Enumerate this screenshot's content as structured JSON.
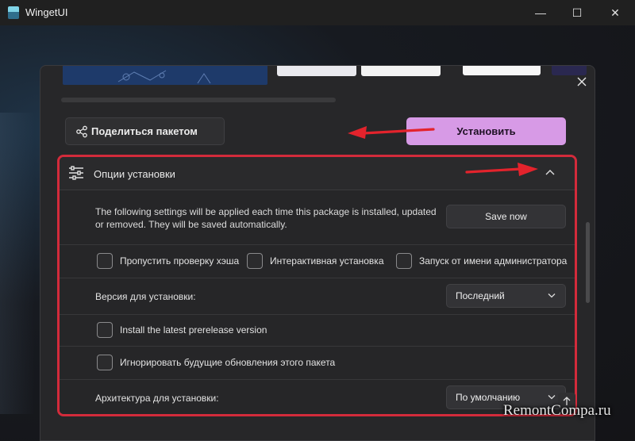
{
  "window": {
    "title": "WingetUI",
    "minimize_glyph": "—",
    "maximize_glyph": "☐",
    "close_glyph": "✕"
  },
  "dialog": {
    "share_button_label": "Поделиться пакетом",
    "install_button_label": "Установить",
    "colors": {
      "install_accent": "#d79ae6",
      "highlight_border": "#d32b3b"
    }
  },
  "install_options": {
    "title": "Опции установки",
    "info_text": "The following settings will be applied each time this package is installed, updated or removed. They will be saved automatically.",
    "save_button_label": "Save now",
    "checkboxes": [
      {
        "label": "Пропустить проверку хэша",
        "checked": false
      },
      {
        "label": "Интерактивная установка",
        "checked": false
      },
      {
        "label": "Запуск от имени администратора",
        "checked": false
      }
    ],
    "version_label": "Версия для установки:",
    "version_value": "Последний",
    "prerelease_label": "Install the latest prerelease version",
    "prerelease_checked": false,
    "ignore_updates_label": "Игнорировать будущие обновления этого пакета",
    "ignore_updates_checked": false,
    "architecture_label": "Архитектура для установки:",
    "architecture_value": "По умолчанию"
  },
  "watermark": "RemontCompa.ru"
}
